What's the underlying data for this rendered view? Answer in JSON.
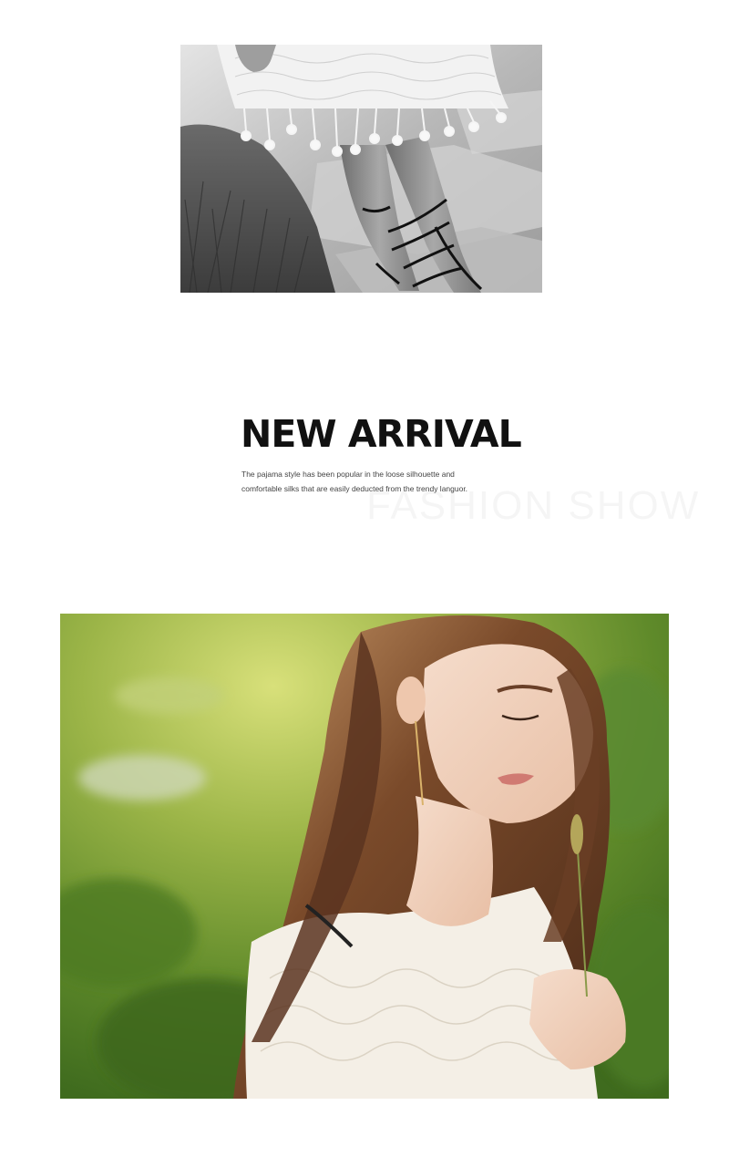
{
  "hero_photo": {
    "alt": "black and white photo of legs in lace fringe dress and strappy sandals"
  },
  "heading": {
    "title": "NEW ARRIVAL",
    "desc_line1": "The pajama style has been popular in the loose silhouette and",
    "desc_line2": "comfortable silks that are easily deducted from the trendy languor.",
    "watermark": "FASHION SHOW"
  },
  "feature_photo": {
    "alt": "woman with long brown hair in white crochet top holding a grass stem"
  }
}
